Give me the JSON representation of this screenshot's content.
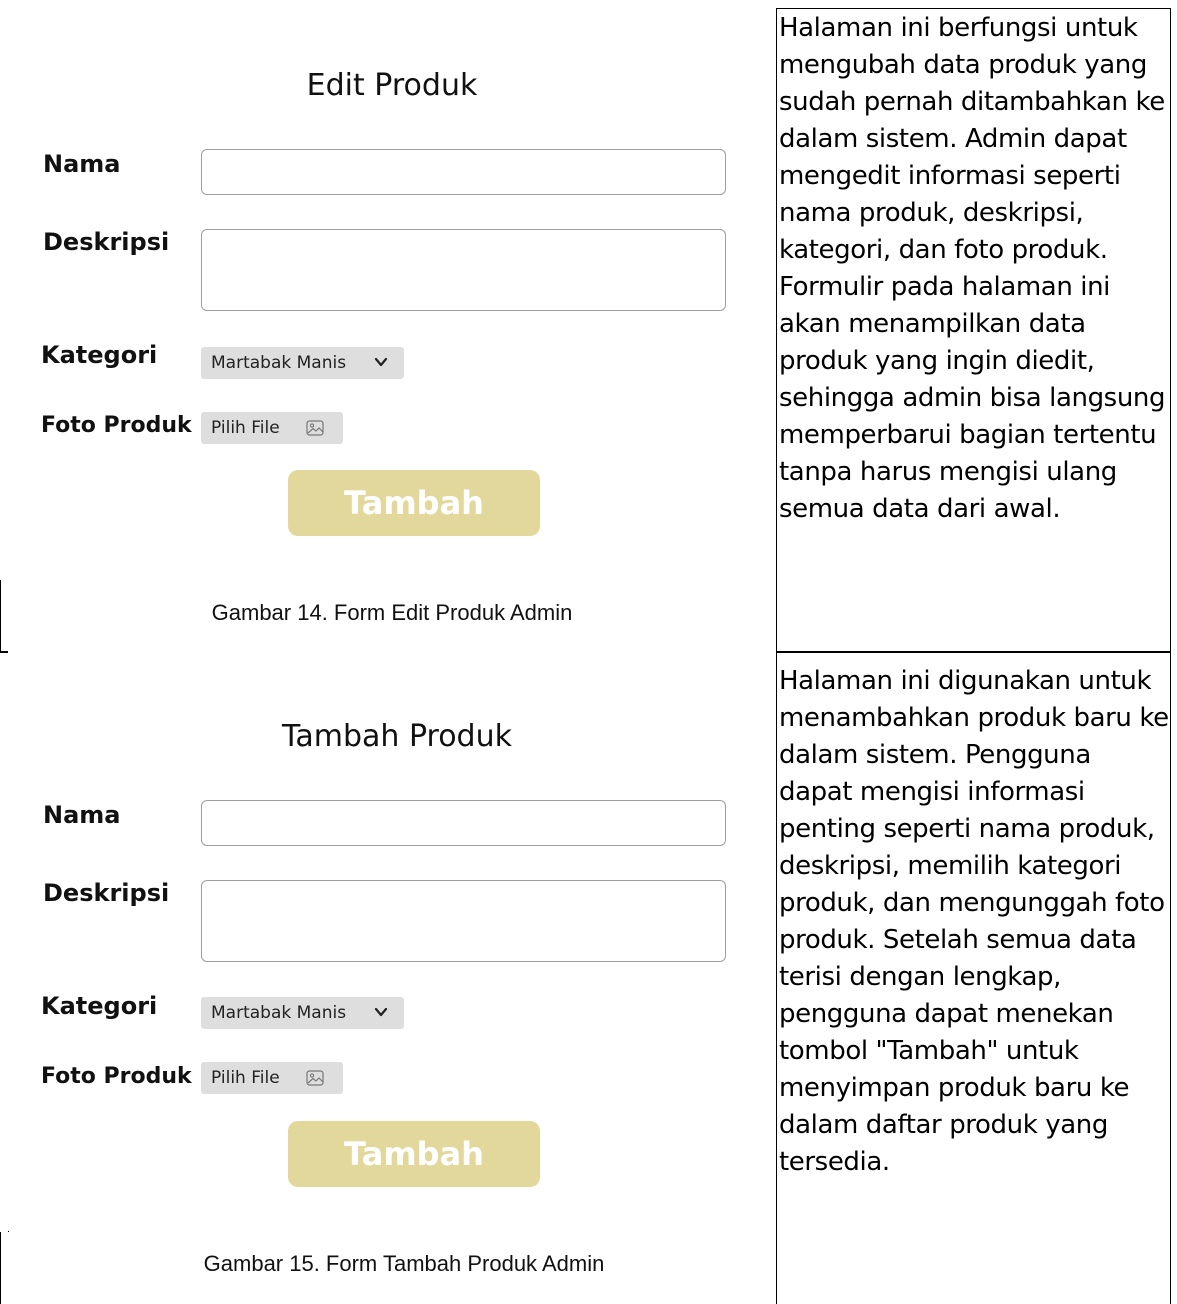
{
  "sections": [
    {
      "form": {
        "title": "Edit Produk",
        "name_label": "Nama",
        "desc_label": "Deskripsi",
        "category_label": "Kategori",
        "category_value": "Martabak Manis",
        "photo_label": "Foto Produk",
        "file_button_label": "Pilih File",
        "submit_label": "Tambah"
      },
      "caption": "Gambar 14. Form Edit Produk Admin",
      "description": "Halaman ini berfungsi untuk mengubah data produk yang sudah pernah ditambahkan ke dalam sistem. Admin dapat mengedit informasi seperti nama produk, deskripsi, kategori, dan foto produk. Formulir pada halaman ini akan menampilkan data produk yang ingin diedit, sehingga admin bisa langsung memperbarui bagian tertentu tanpa harus mengisi ulang semua data dari awal."
    },
    {
      "form": {
        "title": "Tambah Produk",
        "name_label": "Nama",
        "desc_label": "Deskripsi",
        "category_label": "Kategori",
        "category_value": "Martabak Manis",
        "photo_label": "Foto Produk",
        "file_button_label": "Pilih File",
        "submit_label": "Tambah"
      },
      "caption": "Gambar 15. Form Tambah Produk Admin",
      "description": "Halaman ini digunakan untuk menambahkan produk baru ke dalam sistem. Pengguna dapat mengisi informasi penting seperti nama produk, deskripsi, memilih kategori produk, dan mengunggah foto produk. Setelah semua data terisi dengan lengkap, pengguna dapat menekan tombol \"Tambah\" untuk menyimpan produk baru ke dalam daftar produk yang tersedia."
    }
  ],
  "colors": {
    "button_bg": "#e3d89c",
    "field_bg": "#dedede",
    "border": "#000000"
  }
}
